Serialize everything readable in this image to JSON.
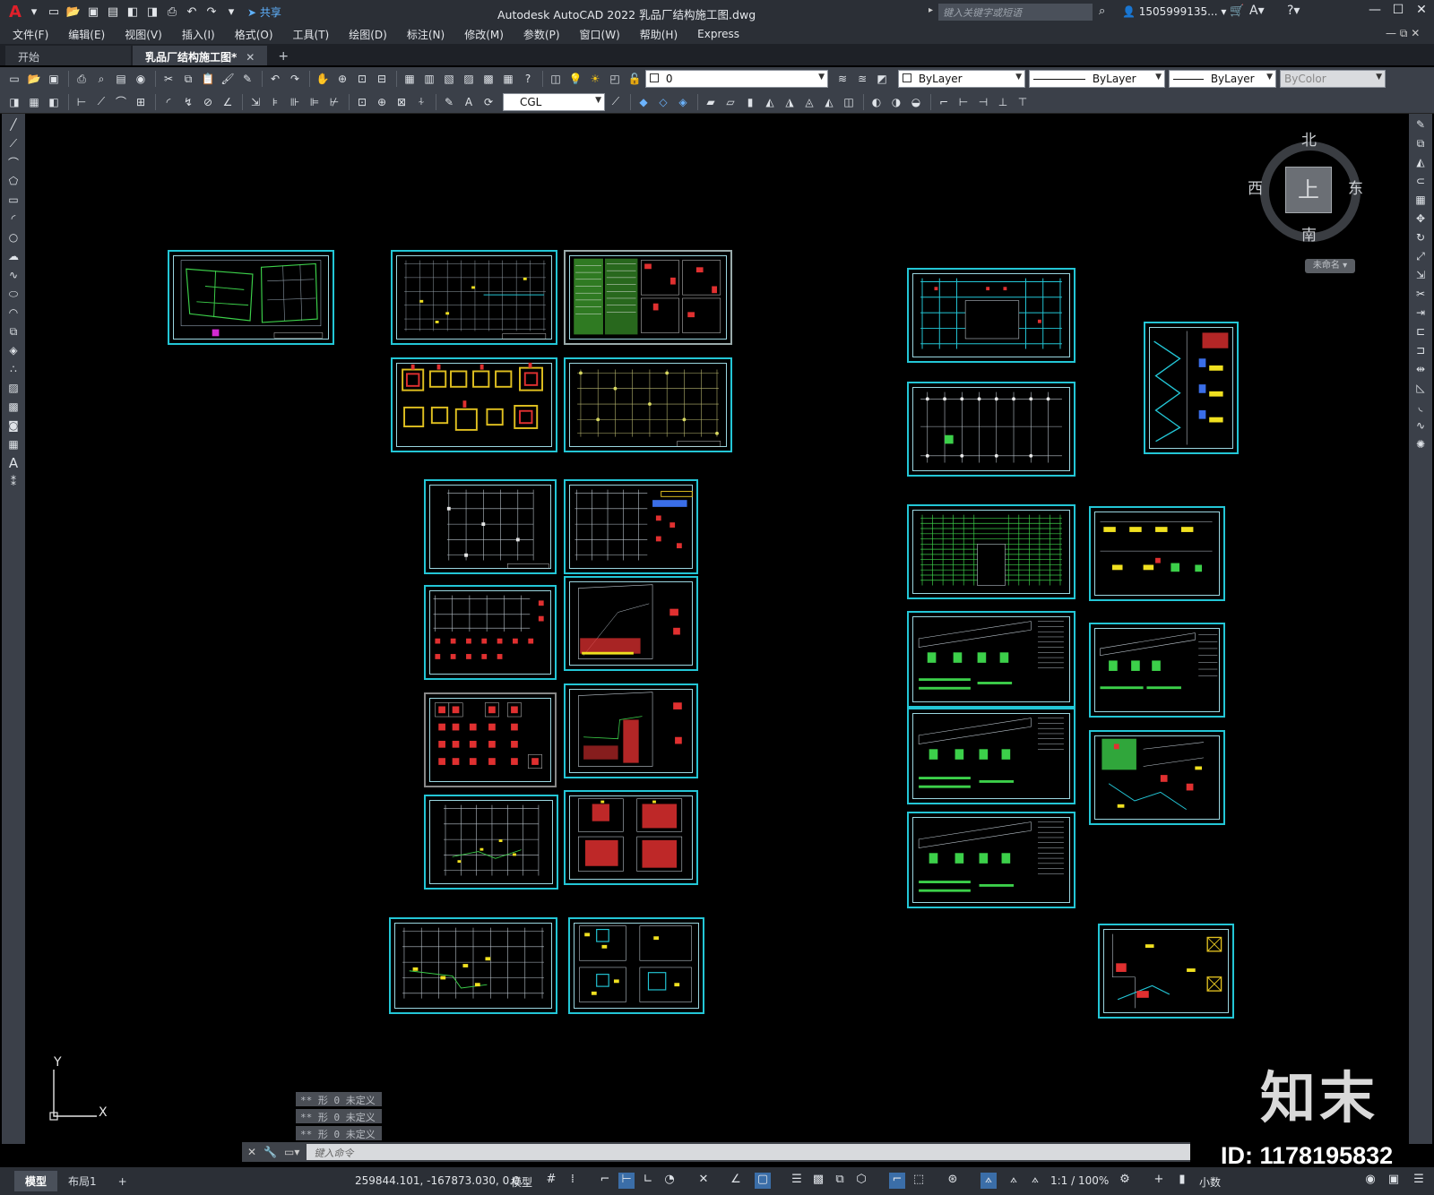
{
  "titlebar": {
    "app_title": "Autodesk AutoCAD 2022    乳品厂结构施工图.dwg",
    "share_label": "共享",
    "search_placeholder": "键入关键字或短语",
    "user": "1505999135...",
    "app_icon": "A"
  },
  "menu": [
    "文件(F)",
    "编辑(E)",
    "视图(V)",
    "插入(I)",
    "格式(O)",
    "工具(T)",
    "绘图(D)",
    "标注(N)",
    "修改(M)",
    "参数(P)",
    "窗口(W)",
    "帮助(H)",
    "Express"
  ],
  "tabs": {
    "start": "开始",
    "document": "乳品厂结构施工图*",
    "close": "✕",
    "add": "+"
  },
  "toolbar": {
    "layer_value": "0",
    "color_value": "ByLayer",
    "linetype_value": "ByLayer",
    "lineweight_value": "ByLayer",
    "plotstyle_value": "ByColor",
    "textstyle_value": "CGL"
  },
  "viewcube": {
    "north": "北",
    "south": "南",
    "east": "东",
    "west": "西",
    "top": "上",
    "named_view": "未命名"
  },
  "ucs": {
    "x": "X",
    "y": "Y"
  },
  "command": {
    "history": [
      "** 形 0 未定义",
      "** 形 0 未定义",
      "** 形 0 未定义"
    ],
    "placeholder": "键入命令"
  },
  "status": {
    "model_tab": "模型",
    "layout_tab": "布局1",
    "add_tab": "+",
    "coordinates": "259844.101, -167873.030, 0.0...",
    "model_button": "模型",
    "annotation_scale": "1:1 / 100%",
    "units": "小数"
  },
  "watermark": {
    "logo": "知末",
    "id": "ID: 1178195832"
  },
  "colors": {
    "frame": "#23c6d6",
    "background": "#000000",
    "ui_dark": "#2b2f36",
    "ui_mid": "#3b4049",
    "accent_red": "#e0202a"
  }
}
